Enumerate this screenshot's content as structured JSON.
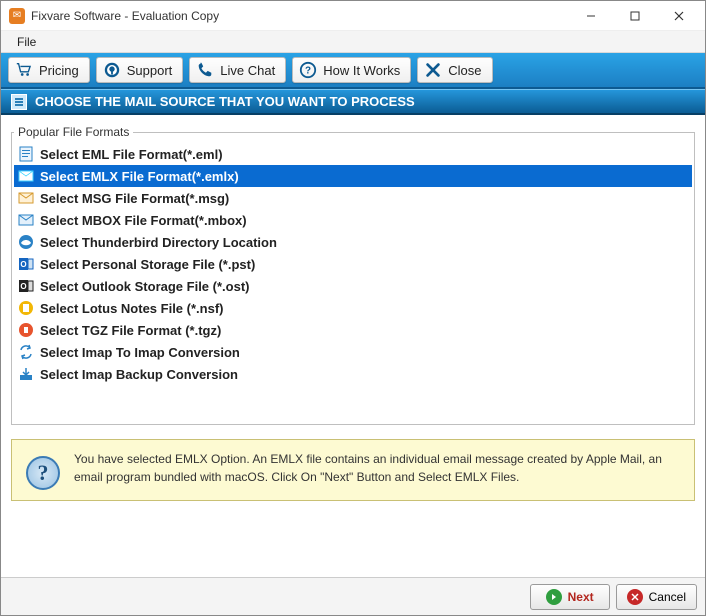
{
  "window": {
    "title": "Fixvare Software - Evaluation Copy"
  },
  "menubar": {
    "items": [
      {
        "label": "File"
      }
    ]
  },
  "toolbar": {
    "items": [
      {
        "id": "pricing",
        "label": "Pricing",
        "icon": "cart-icon"
      },
      {
        "id": "support",
        "label": "Support",
        "icon": "headset-icon"
      },
      {
        "id": "livechat",
        "label": "Live Chat",
        "icon": "phone-icon"
      },
      {
        "id": "howitworks",
        "label": "How It Works",
        "icon": "question-icon"
      },
      {
        "id": "close",
        "label": "Close",
        "icon": "close-x-icon"
      }
    ]
  },
  "banner": {
    "text": "CHOOSE THE MAIL SOURCE THAT YOU WANT TO PROCESS"
  },
  "formats": {
    "legend": "Popular File Formats",
    "selected_index": 1,
    "items": [
      {
        "label": "Select EML File Format(*.eml)"
      },
      {
        "label": "Select EMLX File Format(*.emlx)"
      },
      {
        "label": "Select MSG File Format(*.msg)"
      },
      {
        "label": "Select MBOX File Format(*.mbox)"
      },
      {
        "label": "Select Thunderbird Directory Location"
      },
      {
        "label": "Select Personal Storage File (*.pst)"
      },
      {
        "label": "Select Outlook Storage File (*.ost)"
      },
      {
        "label": "Select Lotus Notes File (*.nsf)"
      },
      {
        "label": "Select TGZ File Format (*.tgz)"
      },
      {
        "label": "Select Imap To Imap Conversion"
      },
      {
        "label": "Select Imap Backup Conversion"
      }
    ]
  },
  "info": {
    "text": "You have selected EMLX Option. An EMLX file contains an individual email message created by Apple Mail, an email program bundled with macOS. Click On \"Next\" Button and Select EMLX Files."
  },
  "footer": {
    "next_label": "Next",
    "cancel_label": "Cancel"
  }
}
